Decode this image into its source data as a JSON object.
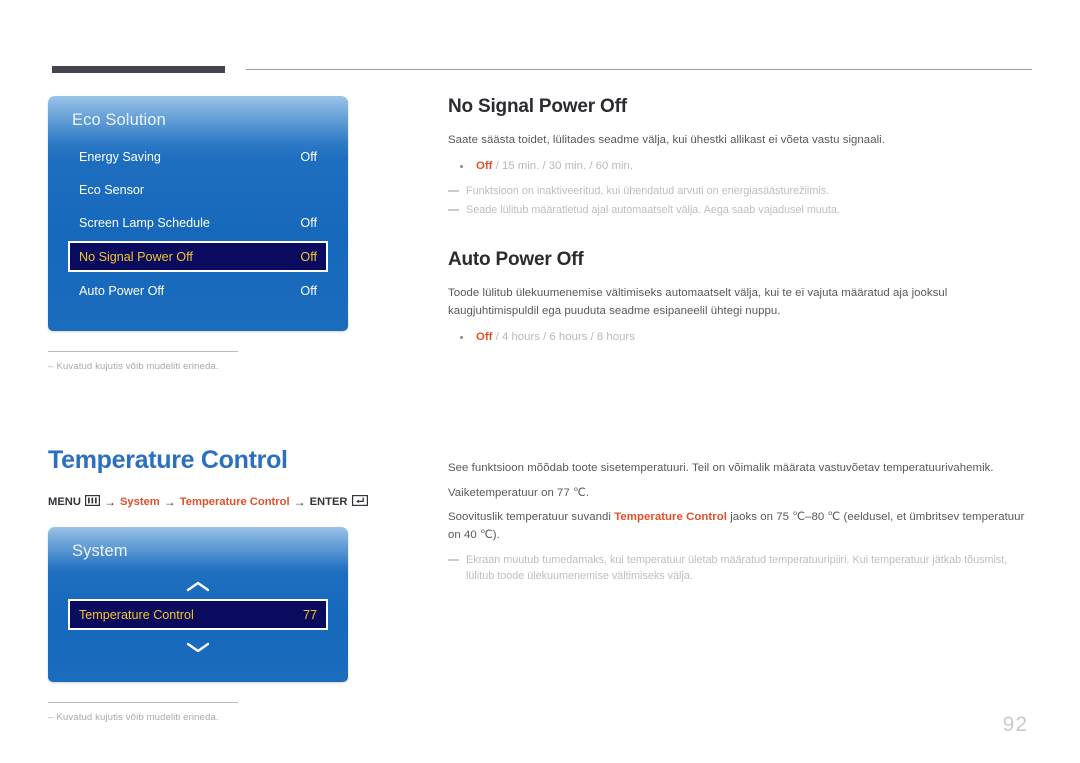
{
  "page": {
    "number": "92"
  },
  "eco_panel": {
    "title": "Eco Solution",
    "rows": [
      {
        "label": "Energy Saving",
        "value": "Off",
        "selected": false
      },
      {
        "label": "Eco Sensor",
        "value": "",
        "selected": false
      },
      {
        "label": "Screen Lamp Schedule",
        "value": "Off",
        "selected": false
      },
      {
        "label": "No Signal Power Off",
        "value": "Off",
        "selected": true
      },
      {
        "label": "Auto Power Off",
        "value": "Off",
        "selected": false
      }
    ],
    "note": {
      "dash": "–",
      "text": "Kuvatud kujutis võib mudeliti erineda."
    }
  },
  "system_panel": {
    "title": "System",
    "chevron_up": "chevron-up-icon",
    "chevron_down": "chevron-down-icon",
    "rows": [
      {
        "label": "Temperature Control",
        "value": "77",
        "selected": true
      }
    ],
    "note": {
      "dash": "–",
      "text": "Kuvatud kujutis võib mudeliti erineda."
    }
  },
  "section_heading": {
    "title": "Temperature Control"
  },
  "breadcrumb": {
    "menu_label": "MENU",
    "menu_icon": "menu-grid-icon",
    "arrow": "→",
    "item1": "System",
    "item2": "Temperature Control",
    "enter_label": "ENTER",
    "enter_icon": "enter-key-icon"
  },
  "no_signal": {
    "title": "No Signal Power Off",
    "body": "Saate säästa toidet, lülitades seadme välja, kui ühestki allikast ei võeta vastu signaali.",
    "options": {
      "bold": "Off",
      "rest": " / 15 min. / 30 min. / 60 min."
    },
    "notes": [
      "Funktsioon on inaktiveeritud, kui ühendatud arvuti on energiasäästurežiimis.",
      "Seade lülitub määratletud ajal automaatselt välja. Aega saab vajadusel muuta."
    ]
  },
  "auto_power_off": {
    "title": "Auto Power Off",
    "body": "Toode lülitub ülekuumenemise vältimiseks automaatselt välja, kui te ei vajuta määratud aja jooksul kaugjuhtimispuldil ega puuduta seadme esipaneelil ühtegi nuppu.",
    "options": {
      "bold": "Off",
      "rest": " / 4 hours / 6 hours / 8 hours"
    }
  },
  "temperature_control": {
    "para1": "See funktsioon mõõdab toote sisetemperatuuri. Teil on võimalik määrata vastuvõetav temperatuurivahemik.",
    "para2": "Vaiketemperatuur on 77 ℃.",
    "para3_pre": "Soovituslik temperatuur suvandi ",
    "para3_em": "Temperature Control",
    "para3_post": " jaoks on 75 ℃–80 ℃ (eeldusel, et ümbritsev temperatuur on 40 ℃).",
    "note": "Ekraan muutub tumedamaks, kui temperatuur ületab määratud temperatuuripiiri. Kui temperatuur jätkab tõusmist, lülitub toode ülekuumenemise vältimiseks välja."
  }
}
